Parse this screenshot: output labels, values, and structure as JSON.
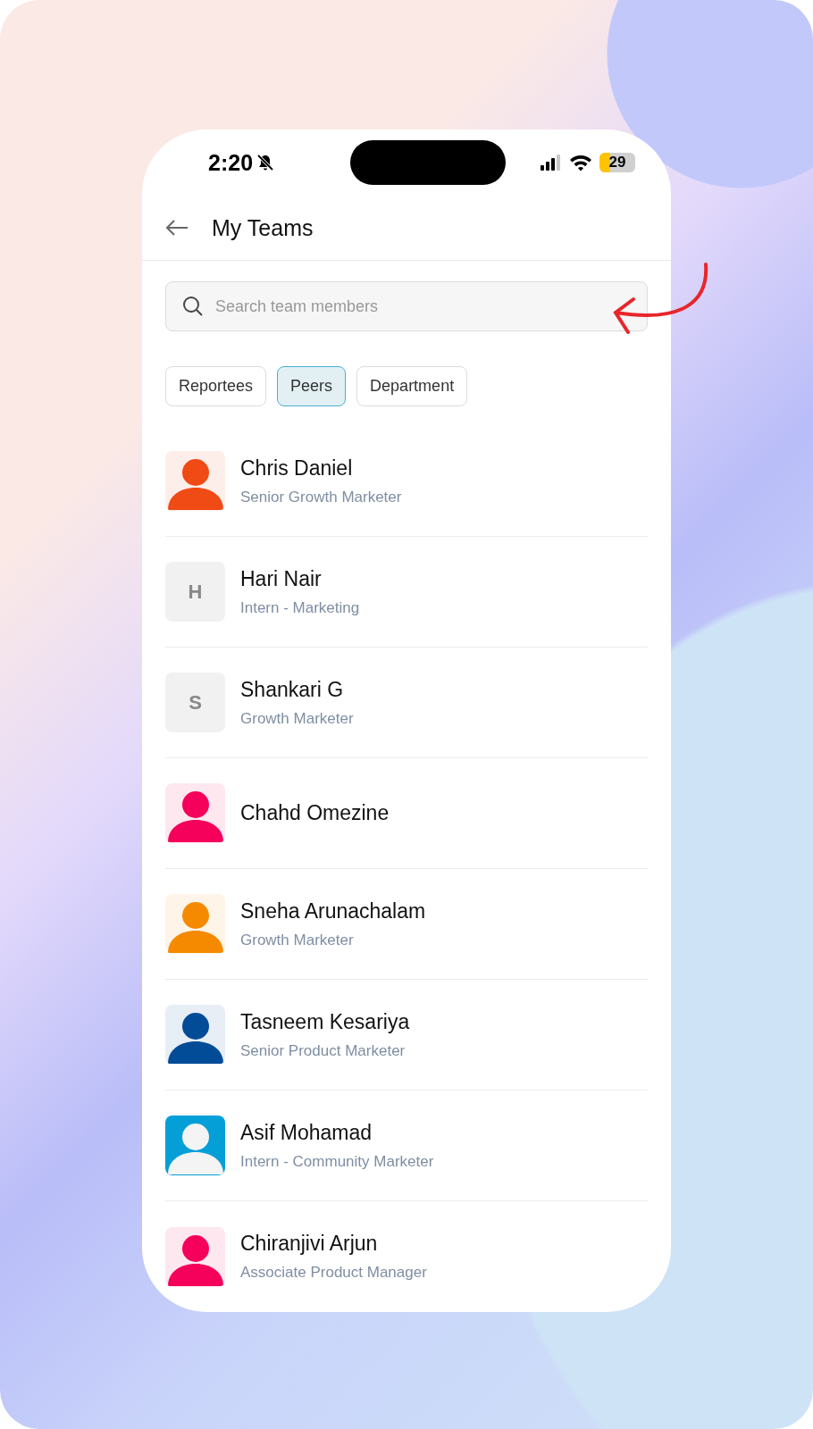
{
  "status_bar": {
    "time": "2:20",
    "silent": true,
    "battery": "29"
  },
  "header": {
    "title": "My Teams"
  },
  "search": {
    "placeholder": "Search team members"
  },
  "filters": [
    {
      "label": "Reportees",
      "selected": false
    },
    {
      "label": "Peers",
      "selected": true
    },
    {
      "label": "Department",
      "selected": false
    }
  ],
  "members": [
    {
      "name": "Chris Daniel",
      "role": "Senior Growth Marketer",
      "avatar": {
        "kind": "figure",
        "color": "#f04a15"
      }
    },
    {
      "name": "Hari Nair",
      "role": "Intern - Marketing",
      "avatar": {
        "kind": "initial",
        "letter": "H"
      }
    },
    {
      "name": "Shankari G",
      "role": "Growth Marketer",
      "avatar": {
        "kind": "initial",
        "letter": "S"
      }
    },
    {
      "name": "Chahd Omezine",
      "avatar": {
        "kind": "figure",
        "color": "#f5005a"
      }
    },
    {
      "name": "Sneha Arunachalam",
      "role": "Growth Marketer",
      "avatar": {
        "kind": "figure",
        "color": "#f58a00"
      }
    },
    {
      "name": "Tasneem Kesariya",
      "role": "Senior Product Marketer",
      "avatar": {
        "kind": "figure",
        "color": "#024c97"
      }
    },
    {
      "name": "Asif Mohamad",
      "role": "Intern - Community Marketer",
      "avatar": {
        "kind": "filled",
        "color": "#059fd8"
      }
    },
    {
      "name": "Chiranjivi Arjun",
      "role": "Associate Product Manager",
      "avatar": {
        "kind": "figure",
        "color": "#f5005a"
      }
    }
  ]
}
